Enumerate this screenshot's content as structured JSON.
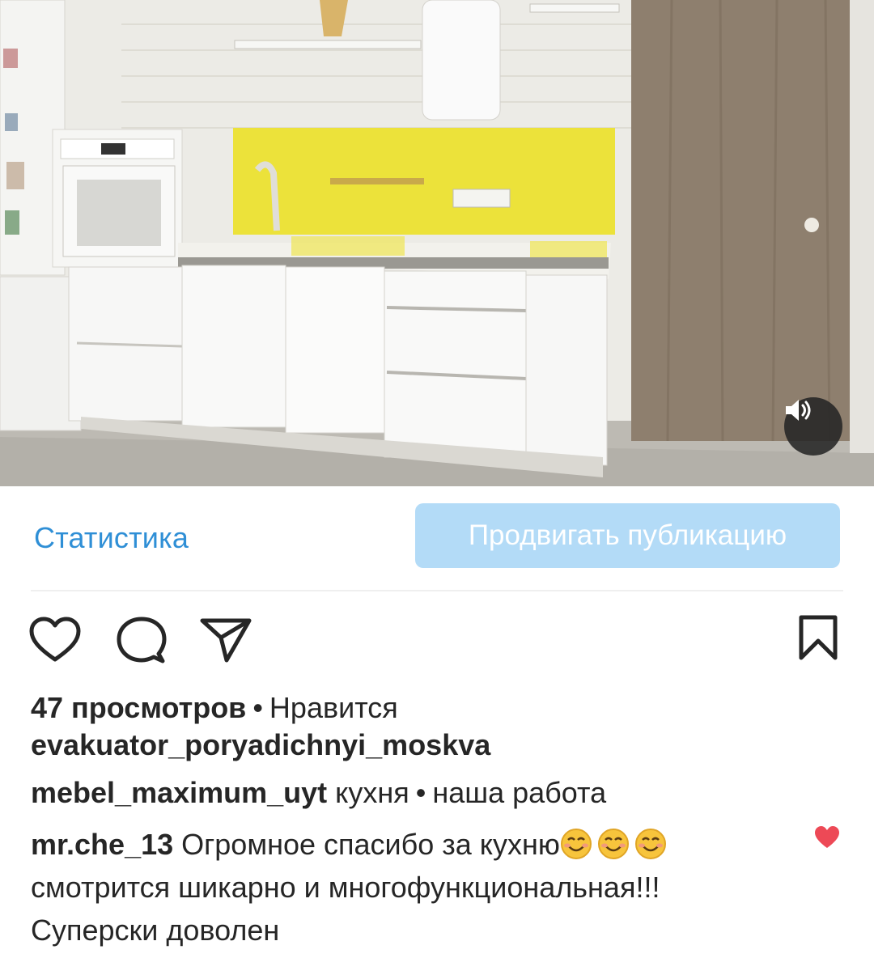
{
  "media": {
    "sound_icon": "speaker-icon"
  },
  "actions": {
    "stats_label": "Статистика",
    "promote_label": "Продвигать публикацию"
  },
  "icons": {
    "like": "heart-outline-icon",
    "comment": "comment-icon",
    "share": "paper-plane-icon",
    "save": "bookmark-icon"
  },
  "post": {
    "views_count": "47 просмотров",
    "separator": "•",
    "liked_by_label": "Нравится",
    "liked_by_user": "evakuator_poryadichnyi_moskva",
    "author": "mebel_maximum_uyt",
    "caption_part1": "кухня",
    "caption_part2": "наша работа"
  },
  "comment": {
    "username": "mr.che_13",
    "line1": "Огромное спасибо за кухню",
    "emoji": "smiling-face-emoji",
    "emoji_count": 3,
    "line2": "смотрится шикарно и многофункциональная!!!",
    "line3": "Суперски доволен",
    "liked": true
  },
  "colors": {
    "link_blue": "#2f8fd6",
    "promote_bg": "#b3dbf7",
    "like_red": "#ed4956",
    "text": "#262626"
  }
}
